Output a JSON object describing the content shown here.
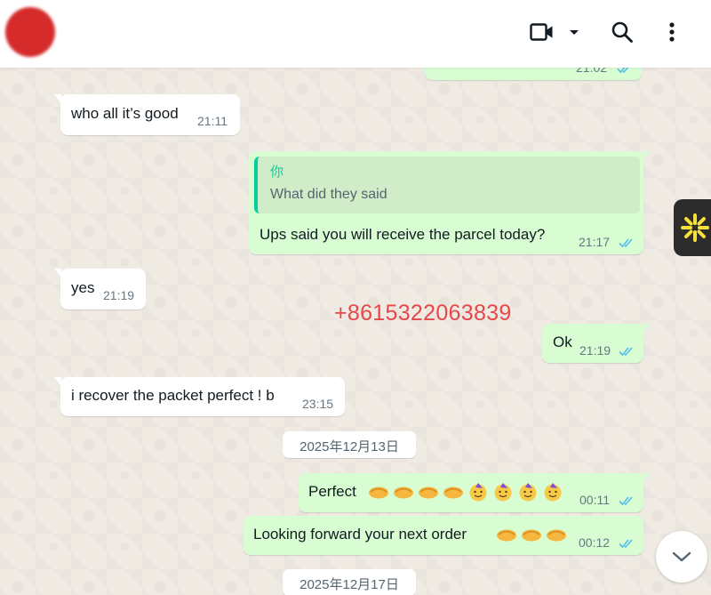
{
  "header": {
    "contact_name_hidden": "",
    "video_icon": "video-camera-icon",
    "dropdown_icon": "caret-down-icon",
    "search_icon": "search-icon",
    "menu_icon": "more-vertical-icon"
  },
  "messages": [
    {
      "direction": "out",
      "text": "",
      "time": "21:02"
    },
    {
      "direction": "in",
      "text": "who all it’s good",
      "time": "21:11"
    },
    {
      "direction": "out",
      "quote_author": "你",
      "quote_text": "What did they said",
      "text": "Ups said you will receive the parcel today?",
      "time": "21:17"
    },
    {
      "direction": "in",
      "text": "yes",
      "time": "21:19"
    },
    {
      "direction": "out",
      "text": "Ok",
      "time": "21:19"
    },
    {
      "direction": "in",
      "text": "i recover the packet perfect ! b",
      "time": "23:15"
    },
    {
      "direction": "out",
      "text": "Perfect",
      "emojis": [
        "handshake",
        "handshake",
        "handshake",
        "handshake",
        "partying-face",
        "partying-face",
        "partying-face",
        "partying-face"
      ],
      "time": "00:11"
    },
    {
      "direction": "out",
      "text": "Looking forward your next order",
      "emojis": [
        "handshake",
        "handshake",
        "handshake"
      ],
      "time": "00:12"
    }
  ],
  "dates": [
    "2025年12月13日",
    "2025年12月17日"
  ],
  "overlay": {
    "phone": "+8615322063839"
  },
  "colors": {
    "incoming_bubble": "#ffffff",
    "outgoing_bubble": "#d9fdd3",
    "read_ticks": "#53bdeb",
    "overlay_text": "#e8474a",
    "quote_accent": "#06cf9c"
  },
  "controls": {
    "scroll_down_icon": "chevron-down-icon",
    "side_badge_icon": "sparkle-icon"
  }
}
